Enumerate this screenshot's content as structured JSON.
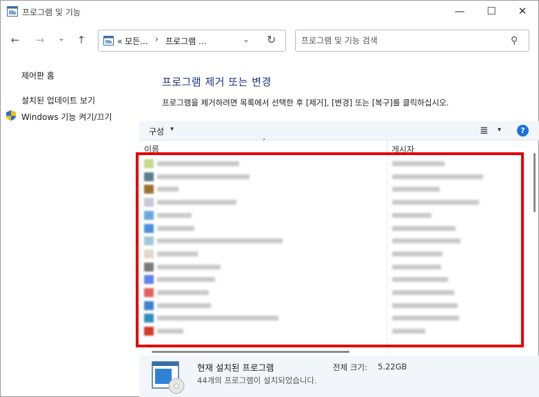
{
  "window": {
    "title": "프로그램 및 기능",
    "min_glyph": "—",
    "max_glyph": "☐",
    "close_glyph": "✕"
  },
  "nav": {
    "back_glyph": "←",
    "forward_glyph": "→",
    "recent_glyph": "⌄",
    "up_glyph": "↑",
    "breadcrumb": [
      "« 모든...",
      "프로그램 ..."
    ],
    "breadcrumb_sep": "›",
    "dropdown_glyph": "⌄",
    "refresh_glyph": "↻"
  },
  "search": {
    "placeholder": "프로그램 및 기능 검색",
    "icon": "search-icon",
    "glyph": "⚲"
  },
  "sidebar": {
    "items": [
      {
        "label": "제어판 홈"
      },
      {
        "label": "설치된 업데이트 보기"
      },
      {
        "label": "Windows 기능 켜기/끄기",
        "icon": "shield-icon"
      }
    ]
  },
  "main": {
    "title": "프로그램 제거 또는 변경",
    "description": "프로그램을 제거하려면 목록에서 선택한 후 [제거], [변경] 또는 [복구]를 클릭하십시오."
  },
  "toolbar": {
    "organize_label": "구성",
    "caret_glyph": "▾",
    "view_glyph": "≣",
    "help_glyph": "?"
  },
  "columns": {
    "name": "이름",
    "publisher": "게시자",
    "sort_glyph": "⌃"
  },
  "programs": [
    {
      "name_w": 0.62,
      "pub_w": 0.47,
      "color": "#c6d98c",
      "blurred": true
    },
    {
      "name_w": 0.7,
      "pub_w": 0.82,
      "color": "#5a7f8c",
      "blurred": true
    },
    {
      "name_w": 0.16,
      "pub_w": 0.43,
      "color": "#9a7330",
      "blurred": true
    },
    {
      "name_w": 0.6,
      "pub_w": 0.78,
      "color": "#c8c8d8",
      "blurred": true
    },
    {
      "name_w": 0.26,
      "pub_w": 0.35,
      "color": "#6aa7e0",
      "blurred": true
    },
    {
      "name_w": 0.28,
      "pub_w": 0.57,
      "color": "#4d8fdf",
      "blurred": true
    },
    {
      "name_w": 0.95,
      "pub_w": 0.61,
      "color": "#9fc9d9",
      "blurred": true
    },
    {
      "name_w": 0.31,
      "pub_w": 0.45,
      "color": "#e4d8c8",
      "blurred": true
    },
    {
      "name_w": 0.48,
      "pub_w": 0.44,
      "color": "#7a7a7a",
      "blurred": true
    },
    {
      "name_w": 0.44,
      "pub_w": 0.5,
      "color": "#5f82e8",
      "blurred": true
    },
    {
      "name_w": 0.39,
      "pub_w": 0.56,
      "color": "#e66060",
      "blurred": true
    },
    {
      "name_w": 0.41,
      "pub_w": 0.59,
      "color": "#3f7fcf",
      "blurred": true
    },
    {
      "name_w": 0.92,
      "pub_w": 0.6,
      "color": "#2f8fbf",
      "blurred": true
    },
    {
      "name_w": 0.2,
      "pub_w": 0.3,
      "color": "#d43a2a",
      "blurred": true
    }
  ],
  "status": {
    "title": "현재 설치된 프로그램",
    "count_text": "44개의 프로그램이 설치되었습니다.",
    "size_label": "전체 크기:",
    "size_value": "5.22GB"
  },
  "colors": {
    "title_blue": "#1e3287",
    "highlight_red": "#e60000",
    "help_blue": "#1a73d9",
    "toolbar_bg": "#f2f5f9"
  }
}
